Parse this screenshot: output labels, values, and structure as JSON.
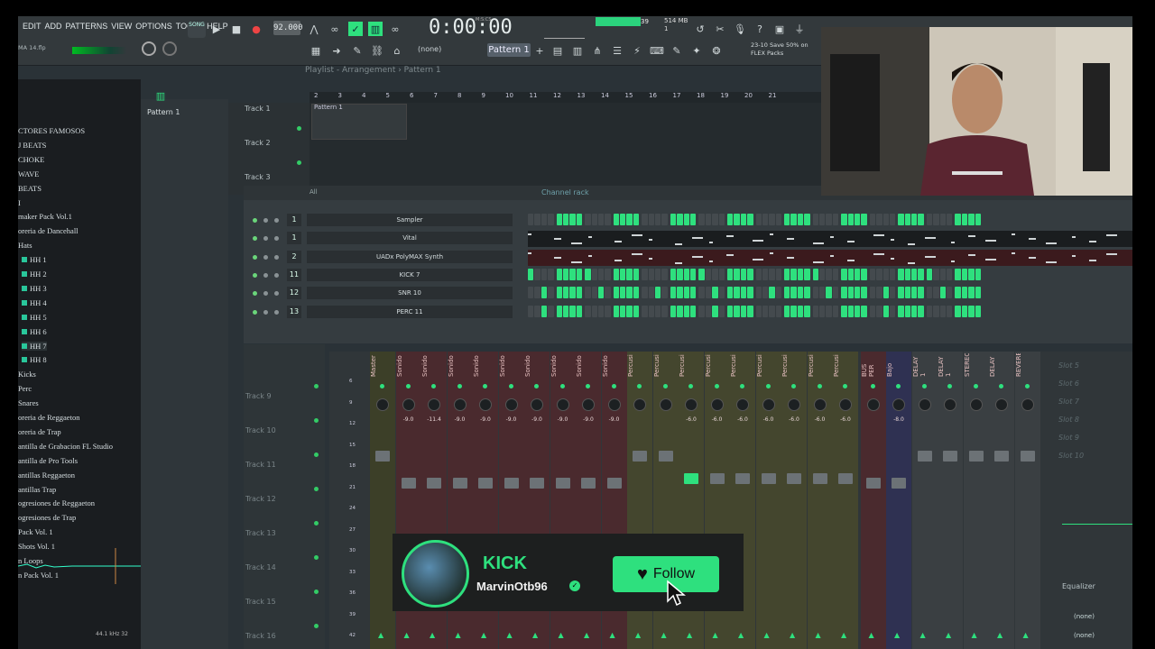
{
  "menu": [
    "EDIT",
    "ADD",
    "PATTERNS",
    "VIEW",
    "OPTIONS",
    "TOOLS",
    "HELP"
  ],
  "transport": {
    "song_label": "SONG",
    "tempo": "92.000",
    "time": "0:00:00",
    "time_label": "M:S:CS",
    "cpu": "39",
    "memory": "514 MB",
    "mem_extra": "1"
  },
  "toolbar": {
    "pattern": "Pattern 1",
    "none": "(none)",
    "hint_line1": "23-10  Save 50% on",
    "hint_line2": "FLEX Packs",
    "snap": "MA 14.flp"
  },
  "playlist": {
    "title": "Playlist - Arrangement › Pattern 1",
    "picker_item": "Pattern 1",
    "clip": "Pattern 1",
    "ruler": [
      "2",
      "3",
      "4",
      "5",
      "6",
      "7",
      "8",
      "9",
      "10",
      "11",
      "12",
      "13",
      "14",
      "15",
      "16",
      "17",
      "18",
      "19",
      "20",
      "21"
    ],
    "tracks": [
      "Track 1",
      "Track 2",
      "Track 3"
    ]
  },
  "browser": {
    "items": [
      "CTORES FAMOSOS",
      "J BEATS",
      "CHOKE",
      "WAVE",
      "BEATS",
      "I",
      "maker Pack Vol.1",
      "oreria de Dancehall",
      "Hats",
      "HH 1",
      "HH 2",
      "HH 3",
      "HH 4",
      "HH 5",
      "HH 6",
      "HH 7",
      "HH 8",
      "Kicks",
      "Perc",
      "Snares",
      "oreria de Reggaeton",
      "oreria de Trap",
      "antilla de Grabacion FL Studio",
      "antilla de Pro Tools",
      "antillas Reggaeton",
      "antillas Trap",
      "ogresiones de Reggaeton",
      "ogresiones de Trap",
      "Pack Vol. 1",
      "Shots Vol. 1",
      "n Loops",
      "n Pack Vol. 1"
    ],
    "sample_rate": "44.1 kHz 32"
  },
  "rack": {
    "filter": "All",
    "title": "Channel rack",
    "channels": [
      {
        "num": "1",
        "name": "Sampler"
      },
      {
        "num": "1",
        "name": "Vital"
      },
      {
        "num": "2",
        "name": "UADx PolyMAX Synth"
      },
      {
        "num": "11",
        "name": "KICK 7"
      },
      {
        "num": "12",
        "name": "SNR 10"
      },
      {
        "num": "13",
        "name": "PERC 11"
      }
    ]
  },
  "mixer": {
    "tracks": [
      "Track 9",
      "Track 10",
      "Track 11",
      "Track 12",
      "Track 13",
      "Track 14",
      "Track 15",
      "Track 16"
    ],
    "scale": [
      "6",
      "9",
      "12",
      "15",
      "18",
      "21",
      "24",
      "27",
      "30",
      "33",
      "36",
      "39",
      "42"
    ],
    "strips": [
      {
        "label": "Master",
        "db": ""
      },
      {
        "label": "Sonido",
        "db": "-9.0"
      },
      {
        "label": "Sonido",
        "db": "-11.4"
      },
      {
        "label": "Sonido",
        "db": "-9.0"
      },
      {
        "label": "Sonido",
        "db": "-9.0"
      },
      {
        "label": "Sonido",
        "db": "-9.0"
      },
      {
        "label": "Sonido",
        "db": "-9.0"
      },
      {
        "label": "Sonido",
        "db": "-9.0"
      },
      {
        "label": "Sonido",
        "db": "-9.0"
      },
      {
        "label": "Sonido",
        "db": "-9.0"
      },
      {
        "label": "Percusi",
        "db": ""
      },
      {
        "label": "Percusi",
        "db": ""
      },
      {
        "label": "Percusi",
        "db": "-6.0"
      },
      {
        "label": "Percusi",
        "db": "-6.0"
      },
      {
        "label": "Percusi",
        "db": "-6.0"
      },
      {
        "label": "Percusi",
        "db": "-6.0"
      },
      {
        "label": "Percusi",
        "db": "-6.0"
      },
      {
        "label": "Percusi",
        "db": "-6.0"
      },
      {
        "label": "Percusi",
        "db": "-6.0"
      },
      {
        "label": "BUS PER",
        "db": ""
      },
      {
        "label": "Bajo",
        "db": "-8.0"
      },
      {
        "label": "DELAY 1",
        "db": ""
      },
      {
        "label": "DELAY 1",
        "db": ""
      },
      {
        "label": "STEREO",
        "db": ""
      },
      {
        "label": "DELAY",
        "db": ""
      },
      {
        "label": "REVERB",
        "db": ""
      }
    ],
    "slots": [
      "Slot 5",
      "Slot 6",
      "Slot 7",
      "Slot 8",
      "Slot 9",
      "Slot 10"
    ],
    "eq": "Equalizer",
    "none1": "(none)",
    "none2": "(none)"
  },
  "popup": {
    "title": "KICK",
    "user": "MarvinOtb96",
    "follow": "Follow",
    "colors": {
      "accent": "#2ee07e"
    }
  }
}
